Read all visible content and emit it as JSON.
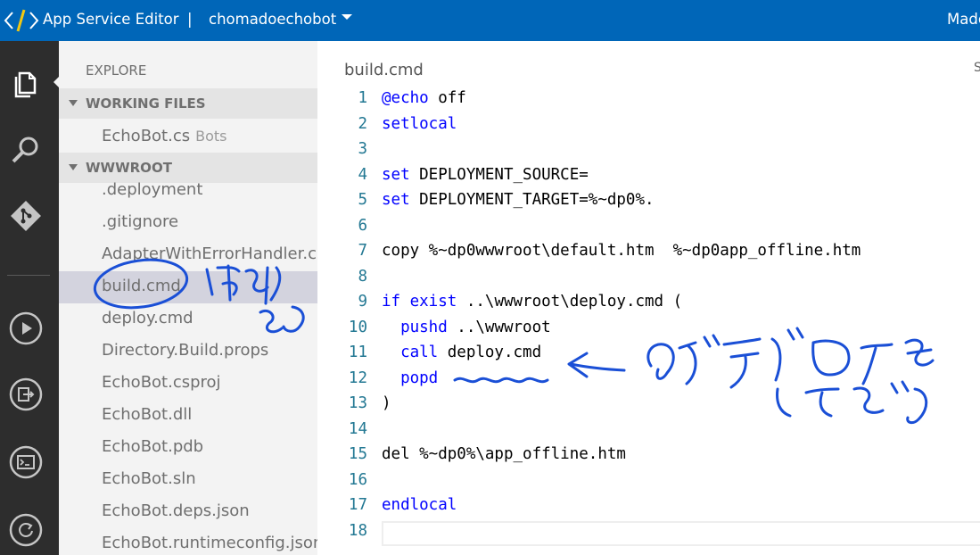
{
  "topbar": {
    "app_title": "App Service Editor",
    "separator": "|",
    "site_name": "chomadoechobot",
    "user": "Made"
  },
  "activity_bar": {
    "items": [
      "explorer-icon",
      "search-icon",
      "git-icon",
      "run-icon",
      "output-icon",
      "console-icon",
      "publish-icon"
    ]
  },
  "explorer": {
    "title": "EXPLORE",
    "working_files": {
      "header": "WORKING FILES",
      "items": [
        {
          "name": "EchoBot.cs",
          "folder": "Bots"
        }
      ]
    },
    "wwwroot": {
      "header": "WWWROOT",
      "items": [
        ".deployment",
        ".gitignore",
        "AdapterWithErrorHandler.cs",
        "build.cmd",
        "deploy.cmd",
        "Directory.Build.props",
        "EchoBot.csproj",
        "EchoBot.dll",
        "EchoBot.pdb",
        "EchoBot.sln",
        "EchoBot.deps.json",
        "EchoBot.runtimeconfig.json"
      ],
      "selected": "build.cmd"
    }
  },
  "editor": {
    "tab_title": "build.cmd",
    "tab_right": "S",
    "lines": [
      {
        "n": "1",
        "kw": "@echo",
        "rest": " off"
      },
      {
        "n": "2",
        "kw": "setlocal",
        "rest": ""
      },
      {
        "n": "3",
        "kw": "",
        "rest": ""
      },
      {
        "n": "4",
        "kw": "set",
        "rest": " DEPLOYMENT_SOURCE="
      },
      {
        "n": "5",
        "kw": "set",
        "rest": " DEPLOYMENT_TARGET=%~dp0%."
      },
      {
        "n": "6",
        "kw": "",
        "rest": ""
      },
      {
        "n": "7",
        "kw": "",
        "rest": "copy %~dp0wwwroot\\default.htm  %~dp0app_offline.htm"
      },
      {
        "n": "8",
        "kw": "",
        "rest": ""
      },
      {
        "n": "9",
        "kw": "if exist",
        "rest": " ..\\wwwroot\\deploy.cmd ("
      },
      {
        "n": "10",
        "kw": "  pushd",
        "rest": " ..\\wwwroot"
      },
      {
        "n": "11",
        "kw": "  call",
        "rest": " deploy.cmd"
      },
      {
        "n": "12",
        "kw": "  popd",
        "rest": ""
      },
      {
        "n": "13",
        "kw": "",
        "rest": ")"
      },
      {
        "n": "14",
        "kw": "",
        "rest": ""
      },
      {
        "n": "15",
        "kw": "",
        "rest": "del %~dp0%\\app_offline.htm"
      },
      {
        "n": "16",
        "kw": "",
        "rest": ""
      },
      {
        "n": "17",
        "kw": "endlocal",
        "rest": ""
      },
      {
        "n": "18",
        "kw": "",
        "rest": ""
      }
    ]
  },
  "colors": {
    "topbar": "#0066b8",
    "activity": "#2d2d2d",
    "sidebar": "#f3f3f3",
    "keyword": "#0000ff",
    "line_number": "#237893",
    "annotation_ink": "#1a4fd6"
  }
}
